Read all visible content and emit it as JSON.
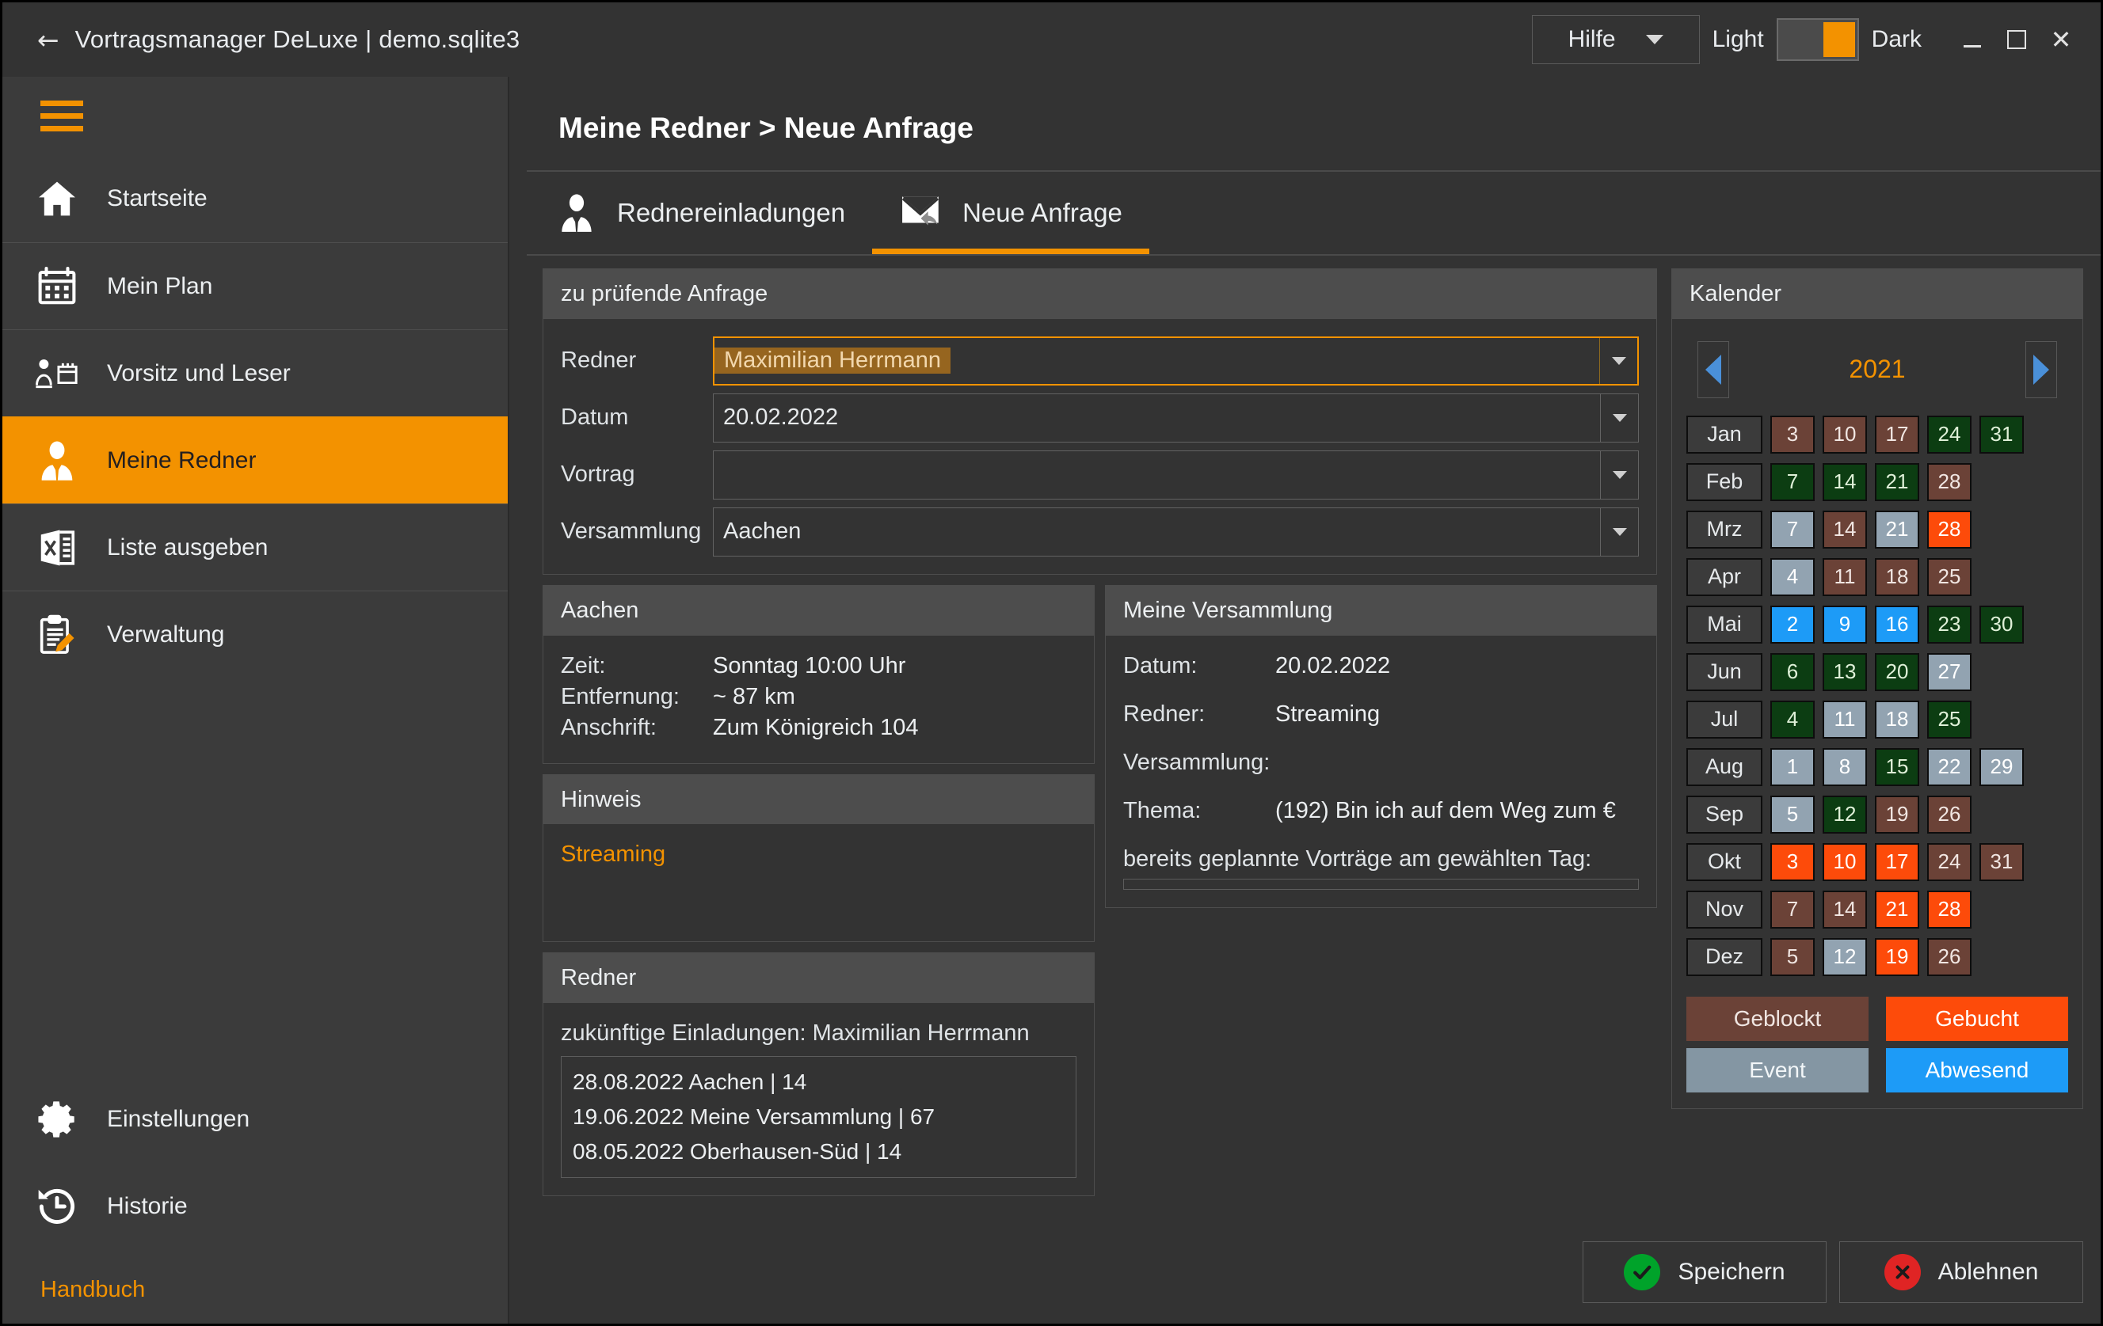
{
  "titlebar": {
    "back_icon": "arrow-left-icon",
    "title": "Vortragsmanager DeLuxe | demo.sqlite3",
    "help_label": "Hilfe",
    "theme_light_label": "Light",
    "theme_dark_label": "Dark",
    "minimize_label": "",
    "maximize_label": "",
    "close_label": "✕"
  },
  "sidebar": {
    "menu_icon": "hamburger-icon",
    "items": [
      {
        "label": "Startseite",
        "icon": "home-icon",
        "active": false
      },
      {
        "label": "Mein Plan",
        "icon": "calendar-icon",
        "active": false
      },
      {
        "label": "Vorsitz und Leser",
        "icon": "chairman-icon",
        "active": false
      },
      {
        "label": "Meine Redner",
        "icon": "speaker-icon",
        "active": true
      },
      {
        "label": "Liste ausgeben",
        "icon": "excel-icon",
        "active": false
      },
      {
        "label": "Verwaltung",
        "icon": "clipboard-edit-icon",
        "active": false
      }
    ],
    "bottom_items": [
      {
        "label": "Einstellungen",
        "icon": "gear-icon"
      },
      {
        "label": "Historie",
        "icon": "history-icon"
      }
    ],
    "manual_label": "Handbuch"
  },
  "main": {
    "page_title": "Meine Redner > Neue Anfrage",
    "tabs": [
      {
        "label": "Rednereinladungen",
        "icon": "speaker-icon",
        "active": false
      },
      {
        "label": "Neue Anfrage",
        "icon": "mail-reply-icon",
        "active": true
      }
    ]
  },
  "request_form": {
    "title": "zu prüfende Anfrage",
    "fields": [
      {
        "label": "Redner",
        "value": "Maximilian Herrmann",
        "selected": true,
        "focused": true
      },
      {
        "label": "Datum",
        "value": "20.02.2022",
        "selected": false,
        "focused": false
      },
      {
        "label": "Vortrag",
        "value": "",
        "selected": false,
        "focused": false
      },
      {
        "label": "Versammlung",
        "value": "Aachen",
        "selected": false,
        "focused": false
      }
    ]
  },
  "congregation_panel": {
    "title": "Aachen",
    "rows": [
      {
        "key": "Zeit:",
        "value": "Sonntag 10:00 Uhr"
      },
      {
        "key": "Entfernung:",
        "value": "~ 87 km"
      },
      {
        "key": "Anschrift:",
        "value": "Zum Königreich 104"
      }
    ]
  },
  "hinweis_panel": {
    "title": "Hinweis",
    "text": "Streaming"
  },
  "speaker_panel": {
    "title": "Redner",
    "subtitle": "zukünftige Einladungen: Maximilian Herrmann",
    "invitations": [
      "28.08.2022 Aachen | 14",
      "19.06.2022 Meine Versammlung | 67",
      "08.05.2022 Oberhausen-Süd | 14"
    ]
  },
  "my_congregation_panel": {
    "title": "Meine Versammlung",
    "rows": [
      {
        "key": "Datum:",
        "value": "20.02.2022"
      },
      {
        "key": "Redner:",
        "value": "Streaming"
      },
      {
        "key": "Versammlung:",
        "value": ""
      },
      {
        "key": "Thema:",
        "value": "(192) Bin ich auf dem Weg zum €"
      }
    ],
    "note": "bereits geplannte Vorträge am gewählten Tag:"
  },
  "calendar": {
    "title": "Kalender",
    "prev_icon": "chevron-left-icon",
    "next_icon": "chevron-right-icon",
    "year": "2021",
    "rows": [
      {
        "month": "Jan",
        "days": [
          {
            "d": "3",
            "state": "geblockt"
          },
          {
            "d": "10",
            "state": "geblockt"
          },
          {
            "d": "17",
            "state": "geblockt"
          },
          {
            "d": "24",
            "state": "frei"
          },
          {
            "d": "31",
            "state": "frei"
          }
        ]
      },
      {
        "month": "Feb",
        "days": [
          {
            "d": "7",
            "state": "frei"
          },
          {
            "d": "14",
            "state": "frei"
          },
          {
            "d": "21",
            "state": "frei"
          },
          {
            "d": "28",
            "state": "geblockt"
          }
        ]
      },
      {
        "month": "Mrz",
        "days": [
          {
            "d": "7",
            "state": "event"
          },
          {
            "d": "14",
            "state": "geblockt"
          },
          {
            "d": "21",
            "state": "event"
          },
          {
            "d": "28",
            "state": "gebucht"
          }
        ]
      },
      {
        "month": "Apr",
        "days": [
          {
            "d": "4",
            "state": "event"
          },
          {
            "d": "11",
            "state": "geblockt"
          },
          {
            "d": "18",
            "state": "geblockt"
          },
          {
            "d": "25",
            "state": "geblockt"
          }
        ]
      },
      {
        "month": "Mai",
        "days": [
          {
            "d": "2",
            "state": "abwesend"
          },
          {
            "d": "9",
            "state": "abwesend"
          },
          {
            "d": "16",
            "state": "abwesend"
          },
          {
            "d": "23",
            "state": "frei"
          },
          {
            "d": "30",
            "state": "frei"
          }
        ]
      },
      {
        "month": "Jun",
        "days": [
          {
            "d": "6",
            "state": "frei"
          },
          {
            "d": "13",
            "state": "frei"
          },
          {
            "d": "20",
            "state": "frei"
          },
          {
            "d": "27",
            "state": "event"
          }
        ]
      },
      {
        "month": "Jul",
        "days": [
          {
            "d": "4",
            "state": "frei"
          },
          {
            "d": "11",
            "state": "event"
          },
          {
            "d": "18",
            "state": "event"
          },
          {
            "d": "25",
            "state": "frei"
          }
        ]
      },
      {
        "month": "Aug",
        "days": [
          {
            "d": "1",
            "state": "event"
          },
          {
            "d": "8",
            "state": "event"
          },
          {
            "d": "15",
            "state": "frei"
          },
          {
            "d": "22",
            "state": "event"
          },
          {
            "d": "29",
            "state": "event"
          }
        ]
      },
      {
        "month": "Sep",
        "days": [
          {
            "d": "5",
            "state": "event"
          },
          {
            "d": "12",
            "state": "frei"
          },
          {
            "d": "19",
            "state": "geblockt"
          },
          {
            "d": "26",
            "state": "geblockt"
          }
        ]
      },
      {
        "month": "Okt",
        "days": [
          {
            "d": "3",
            "state": "gebucht"
          },
          {
            "d": "10",
            "state": "gebucht"
          },
          {
            "d": "17",
            "state": "gebucht"
          },
          {
            "d": "24",
            "state": "geblockt"
          },
          {
            "d": "31",
            "state": "geblockt"
          }
        ]
      },
      {
        "month": "Nov",
        "days": [
          {
            "d": "7",
            "state": "geblockt"
          },
          {
            "d": "14",
            "state": "geblockt"
          },
          {
            "d": "21",
            "state": "gebucht"
          },
          {
            "d": "28",
            "state": "gebucht"
          }
        ]
      },
      {
        "month": "Dez",
        "days": [
          {
            "d": "5",
            "state": "geblockt"
          },
          {
            "d": "12",
            "state": "event"
          },
          {
            "d": "19",
            "state": "gebucht"
          },
          {
            "d": "26",
            "state": "geblockt"
          }
        ]
      }
    ],
    "legend": [
      {
        "label": "Geblockt",
        "key": "geblockt",
        "color": "#6b4237"
      },
      {
        "label": "Gebucht",
        "key": "gebucht",
        "color": "#fd4b0a"
      },
      {
        "label": "Event",
        "key": "event",
        "color": "#8496a3"
      },
      {
        "label": "Abwesend",
        "key": "abwesend",
        "color": "#1d9bf7"
      }
    ]
  },
  "footer": {
    "save_label": "Speichern",
    "reject_label": "Ablehnen"
  },
  "theme": {
    "accent": "#f39200",
    "window_bg": "#333333",
    "sidebar_bg": "#3b3b3b",
    "panel_header_bg": "#4d4d4d",
    "text": "#eceff1"
  }
}
